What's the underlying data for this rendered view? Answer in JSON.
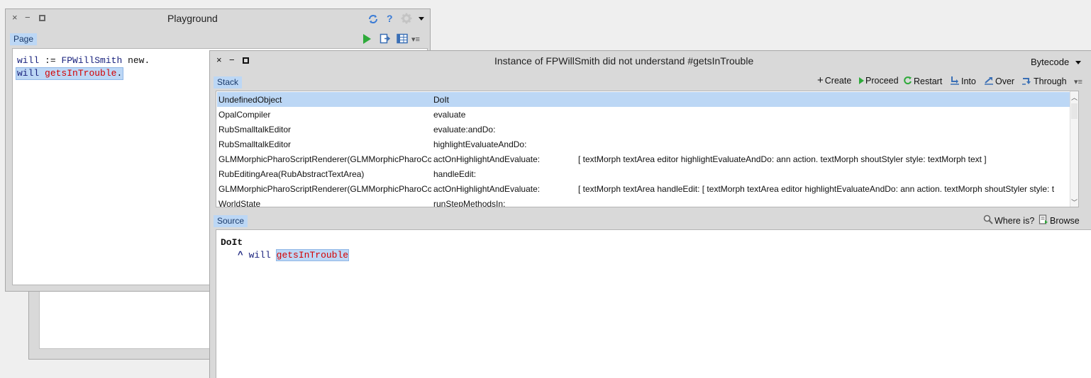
{
  "playground": {
    "title": "Playground",
    "tab_label": "Page",
    "code": [
      {
        "var": "will",
        "op": " := ",
        "cls": "FPWillSmith",
        "rest": " new."
      },
      {
        "var": "will",
        "sel": "getsInTrouble",
        "rest": "."
      }
    ]
  },
  "debugger": {
    "title": "Instance of FPWillSmith did not understand #getsInTrouble",
    "bytecode_label": "Bytecode",
    "stack_tab": "Stack",
    "source_tab": "Source",
    "toolbar": {
      "create": "Create",
      "proceed": "Proceed",
      "restart": "Restart",
      "into": "Into",
      "over": "Over",
      "through": "Through"
    },
    "source_toolbar": {
      "where_is": "Where is?",
      "browse": "Browse"
    },
    "stack": [
      {
        "cls": "UndefinedObject",
        "method": "DoIt",
        "code": "",
        "selected": true
      },
      {
        "cls": "OpalCompiler",
        "method": "evaluate",
        "code": ""
      },
      {
        "cls": "RubSmalltalkEditor",
        "method": "evaluate:andDo:",
        "code": ""
      },
      {
        "cls": "RubSmalltalkEditor",
        "method": "highlightEvaluateAndDo:",
        "code": ""
      },
      {
        "cls": "GLMMorphicPharoScriptRenderer(GLMMorphicPharoCc",
        "method": "actOnHighlightAndEvaluate:",
        "code": "[ textMorph textArea editor highlightEvaluateAndDo: ann action. textMorph shoutStyler style: textMorph text ]"
      },
      {
        "cls": "RubEditingArea(RubAbstractTextArea)",
        "method": "handleEdit:",
        "code": ""
      },
      {
        "cls": "GLMMorphicPharoScriptRenderer(GLMMorphicPharoCc",
        "method": "actOnHighlightAndEvaluate:",
        "code": "[ textMorph textArea  handleEdit: [ textMorph textArea editor highlightEvaluateAndDo: ann action.   textMorph shoutStyler style: t"
      },
      {
        "cls": "WorldState",
        "method": "runStepMethodsIn:",
        "code": ""
      }
    ],
    "source": {
      "header": "DoIt",
      "caret": "^",
      "var": "will",
      "sel": "getsInTrouble"
    }
  }
}
